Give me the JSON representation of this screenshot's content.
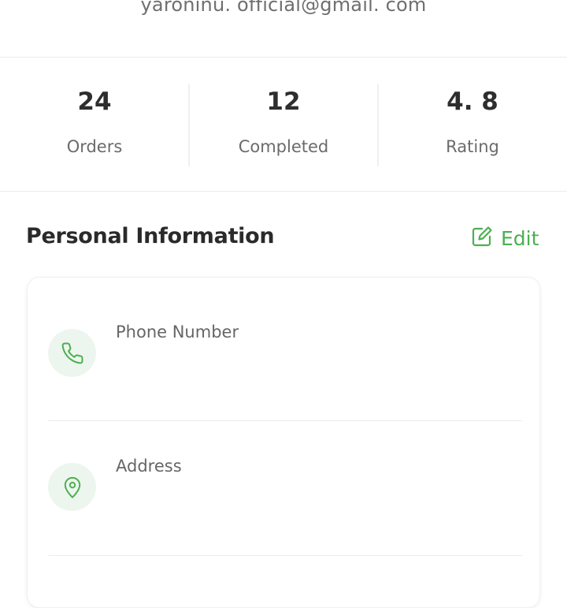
{
  "profile": {
    "email": "yaroninu. official@gmail. com"
  },
  "stats": [
    {
      "value": "24",
      "label": "Orders"
    },
    {
      "value": "12",
      "label": "Completed"
    },
    {
      "value": "4. 8",
      "label": "Rating"
    }
  ],
  "personal_info": {
    "title": "Personal Information",
    "edit_label": "Edit",
    "rows": [
      {
        "label": "Phone Number",
        "icon": "phone-icon"
      },
      {
        "label": "Address",
        "icon": "location-pin-icon"
      }
    ]
  },
  "colors": {
    "accent": "#4caf50",
    "icon_bg": "#edf6ee"
  }
}
